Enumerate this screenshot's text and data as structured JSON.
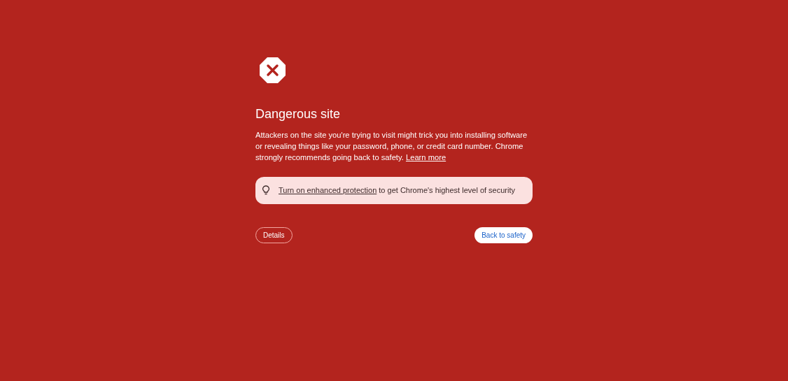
{
  "heading": "Dangerous site",
  "message": {
    "text": "Attackers on the site you're trying to visit might trick you into installing software or revealing things like your password, phone, or credit card number. Chrome strongly recommends going back to safety.",
    "link": "Learn more"
  },
  "banner": {
    "link": "Turn on enhanced protection",
    "text": "to get Chrome's highest level of security"
  },
  "buttons": {
    "details": "Details",
    "back": "Back to safety"
  }
}
